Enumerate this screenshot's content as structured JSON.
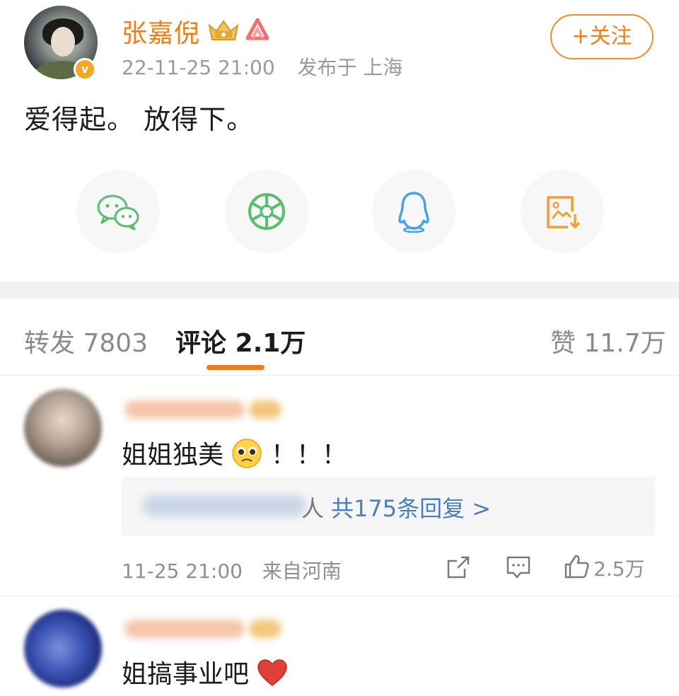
{
  "post": {
    "author": "张嘉倪",
    "timestamp": "22-11-25 21:00",
    "location": "发布于 上海",
    "follow_label": "+关注",
    "text": "爱得起。 放得下。",
    "verified_badge": "v"
  },
  "share": [
    {
      "name": "wechat",
      "icon": "wechat-icon",
      "color": "#5bbd72"
    },
    {
      "name": "moments",
      "icon": "moments-icon",
      "color": "#5bbd72"
    },
    {
      "name": "qq",
      "icon": "qq-icon",
      "color": "#4aa3e0"
    },
    {
      "name": "save-image",
      "icon": "save-image-icon",
      "color": "#f0a030"
    }
  ],
  "tabs": {
    "repost": "转发 7803",
    "comments": "评论 2.1万",
    "likes": "赞 11.7万"
  },
  "comments": [
    {
      "text": "姐姐独美",
      "trail": "！！！",
      "reply_link": "共175条回复 >",
      "reply_prefix": "人",
      "time": "11-25 21:00",
      "source": "来自河南",
      "likes": "2.5万"
    },
    {
      "text": "姐搞事业吧"
    }
  ],
  "colors": {
    "accent": "#f07c1a",
    "link": "#4a7fbf",
    "muted": "#8f8f8f"
  }
}
